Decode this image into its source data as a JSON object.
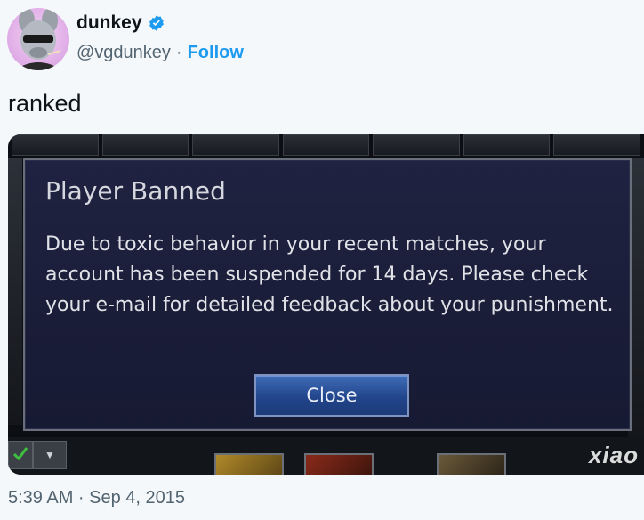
{
  "tweet": {
    "display_name": "dunkey",
    "handle": "@vgdunkey",
    "separator": "·",
    "follow_label": "Follow",
    "text": "ranked",
    "timestamp": "5:39 AM · Sep 4, 2015",
    "verified_icon": "verified-badge-icon",
    "accent_color": "#1d9bf0"
  },
  "media": {
    "dialog": {
      "title": "Player Banned",
      "body": "Due to toxic behavior in your recent matches, your account has been suspended for 14 days. Please check your e-mail for detailed feedback about your punishment.",
      "close_label": "Close"
    }
  },
  "watermark": {
    "text": "xiao"
  }
}
